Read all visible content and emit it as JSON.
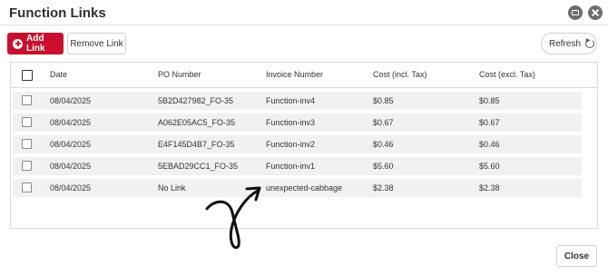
{
  "window": {
    "title": "Function Links",
    "minimize_icon": "window-restore-icon",
    "close_icon": "close-icon"
  },
  "toolbar": {
    "add_label": "Add Link",
    "remove_label": "Remove Link",
    "refresh_label": "Refresh",
    "accent": "#c8102e"
  },
  "table": {
    "columns": [
      "Date",
      "PO Number",
      "Invoice Number",
      "Cost (incl. Tax)",
      "Cost (excl. Tax)"
    ],
    "rows": [
      {
        "date": "08/04/2025",
        "po": "5B2D427982_FO-35",
        "invoice": "Function-inv4",
        "incl": "$0.85",
        "excl": "$0.85"
      },
      {
        "date": "08/04/2025",
        "po": "A062E05AC5_FO-35",
        "invoice": "Function-inv3",
        "incl": "$0.67",
        "excl": "$0.67"
      },
      {
        "date": "08/04/2025",
        "po": "E4F145D4B7_FO-35",
        "invoice": "Function-inv2",
        "incl": "$0.46",
        "excl": "$0.46"
      },
      {
        "date": "08/04/2025",
        "po": "5EBAD29CC1_FO-35",
        "invoice": "Function-inv1",
        "incl": "$5.60",
        "excl": "$5.60"
      },
      {
        "date": "08/04/2025",
        "po": "No Link",
        "invoice": "unexpected-cabbage",
        "incl": "$2.38",
        "excl": "$2.38"
      }
    ]
  },
  "footer": {
    "close_label": "Close"
  }
}
